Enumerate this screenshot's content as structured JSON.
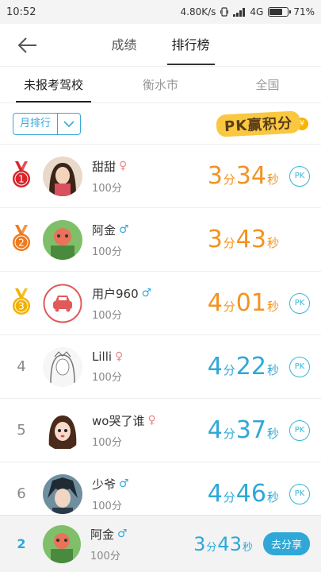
{
  "status_bar": {
    "time": "10:52",
    "speed": "4.80K/s",
    "network": "4G",
    "battery": "71%",
    "battery_level": 0.71
  },
  "header": {
    "tabs": [
      "成绩",
      "排行榜"
    ],
    "active_tab": 1
  },
  "scope_tabs": {
    "items": [
      "未报考驾校",
      "衡水市",
      "全国"
    ],
    "active": 0
  },
  "filter": {
    "dropdown_label": "月排行",
    "banner_text": "PK赢积分",
    "banner_coin": "¥"
  },
  "rankings": [
    {
      "rank": "1",
      "medal": "red",
      "name": "甜甜",
      "gender": "female",
      "gender_symbol": "♀",
      "score": "100分",
      "min": "3",
      "min_unit": "分",
      "sec": "34",
      "sec_unit": "秒",
      "color": "orange",
      "pk": "PK",
      "avatar": "girl-photo"
    },
    {
      "rank": "2",
      "medal": "orange",
      "name": "阿金",
      "gender": "male",
      "gender_symbol": "♂",
      "score": "100分",
      "min": "3",
      "min_unit": "分",
      "sec": "43",
      "sec_unit": "秒",
      "color": "orange",
      "pk": "",
      "avatar": "cartoon-green"
    },
    {
      "rank": "3",
      "medal": "gold",
      "name": "用户960",
      "gender": "male",
      "gender_symbol": "♂",
      "score": "100分",
      "min": "4",
      "min_unit": "分",
      "sec": "01",
      "sec_unit": "秒",
      "color": "orange",
      "pk": "PK",
      "avatar": "car-icon"
    },
    {
      "rank": "4",
      "medal": "",
      "name": "Lilli",
      "gender": "female",
      "gender_symbol": "♀",
      "score": "100分",
      "min": "4",
      "min_unit": "分",
      "sec": "22",
      "sec_unit": "秒",
      "color": "blue",
      "pk": "PK",
      "avatar": "sketch-girl"
    },
    {
      "rank": "5",
      "medal": "",
      "name": "wo哭了谁",
      "gender": "female",
      "gender_symbol": "♀",
      "score": "100分",
      "min": "4",
      "min_unit": "分",
      "sec": "37",
      "sec_unit": "秒",
      "color": "blue",
      "pk": "PK",
      "avatar": "doll-girl"
    },
    {
      "rank": "6",
      "medal": "",
      "name": "少爷",
      "gender": "male",
      "gender_symbol": "♂",
      "score": "100分",
      "min": "4",
      "min_unit": "分",
      "sec": "46",
      "sec_unit": "秒",
      "color": "blue",
      "pk": "PK",
      "avatar": "anime-boy"
    }
  ],
  "my_rank": {
    "rank": "2",
    "name": "阿金",
    "gender_symbol": "♂",
    "score": "100分",
    "min": "3",
    "min_unit": "分",
    "sec": "43",
    "sec_unit": "秒",
    "share": "去分享"
  },
  "colors": {
    "accent_blue": "#2fa8d8",
    "orange": "#f29320",
    "medal_red": "#d9262c",
    "medal_orange": "#f07a1c",
    "medal_gold": "#f2b100"
  }
}
